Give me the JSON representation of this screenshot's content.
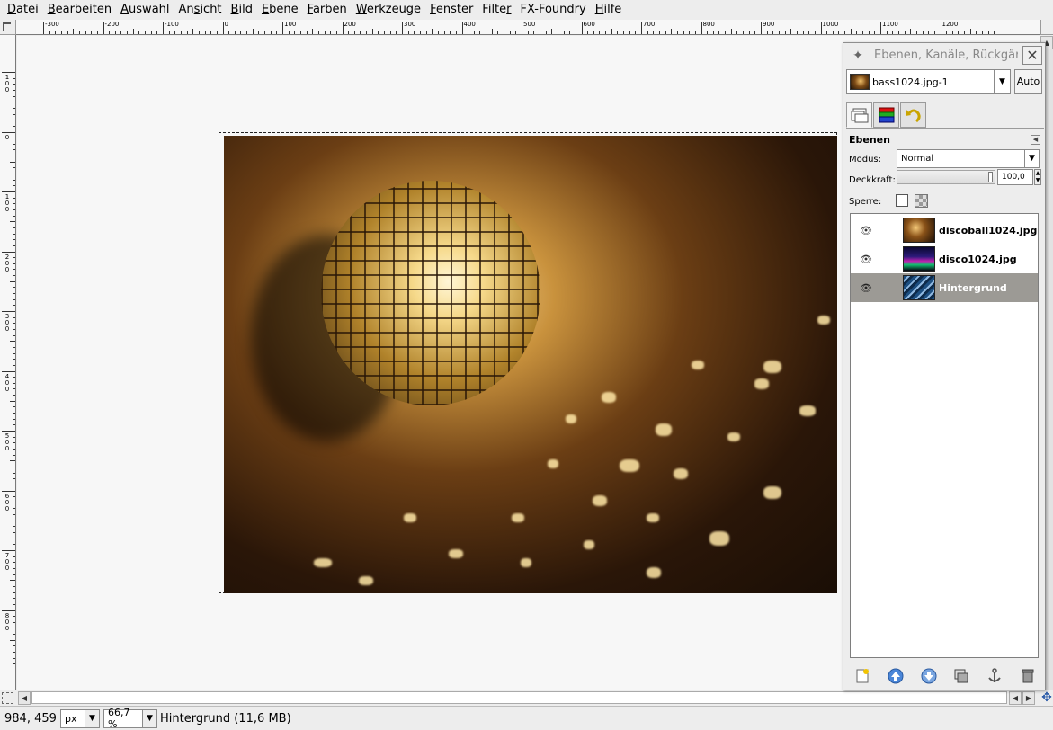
{
  "menubar": {
    "items": [
      {
        "pre": "",
        "mn": "D",
        "post": "atei"
      },
      {
        "pre": "",
        "mn": "B",
        "post": "earbeiten"
      },
      {
        "pre": "",
        "mn": "A",
        "post": "uswahl"
      },
      {
        "pre": "An",
        "mn": "s",
        "post": "icht"
      },
      {
        "pre": "",
        "mn": "B",
        "post": "ild"
      },
      {
        "pre": "",
        "mn": "E",
        "post": "bene"
      },
      {
        "pre": "",
        "mn": "F",
        "post": "arben"
      },
      {
        "pre": "",
        "mn": "W",
        "post": "erkzeuge"
      },
      {
        "pre": "",
        "mn": "F",
        "post": "enster"
      },
      {
        "pre": "Filte",
        "mn": "r",
        "post": ""
      },
      {
        "pre": "FX-Foundry",
        "mn": "",
        "post": ""
      },
      {
        "pre": "",
        "mn": "H",
        "post": "ilfe"
      }
    ]
  },
  "rulers": {
    "horizontal_labels": [
      "-300",
      "-200",
      "-100",
      "0",
      "100",
      "200",
      "300",
      "400",
      "500",
      "600",
      "700",
      "800",
      "900",
      "1000",
      "1100",
      "1200"
    ],
    "vertical_labels": [
      "100",
      "0",
      "100",
      "200",
      "300",
      "400",
      "500",
      "600",
      "700",
      "800"
    ]
  },
  "canvas": {
    "image_name": "bass1024.jpg",
    "quick_mask_icon": "dashed-square-icon",
    "navigate_icon": "navigate-cross-icon"
  },
  "statusbar": {
    "coords": "984, 459",
    "unit": "px",
    "zoom": "66,7 %",
    "message": "Hintergrund (11,6 MB)"
  },
  "dock": {
    "title": "Ebenen, Kanäle, Rückgär",
    "image_selector": "bass1024.jpg-1",
    "auto_button": "Auto",
    "tabs": [
      "layers-tab-icon",
      "channels-tab-icon",
      "undo-tab-icon"
    ],
    "section_title": "Ebenen",
    "mode_label": "Modus:",
    "mode_value": "Normal",
    "opacity_label": "Deckkraft:",
    "opacity_value": "100,0",
    "lock_label": "Sperre:",
    "layers": [
      {
        "name": "discoball1024.jpg",
        "visible": true,
        "selected": false
      },
      {
        "name": "disco1024.jpg",
        "visible": true,
        "selected": false
      },
      {
        "name": "Hintergrund",
        "visible": true,
        "selected": true
      }
    ],
    "buttons": [
      "new-layer-icon",
      "raise-layer-icon",
      "lower-layer-icon",
      "duplicate-layer-icon",
      "anchor-layer-icon",
      "delete-layer-icon"
    ]
  },
  "colors": {
    "selection_bg": "#9c9a95",
    "marching_ants": "#e6c800"
  }
}
